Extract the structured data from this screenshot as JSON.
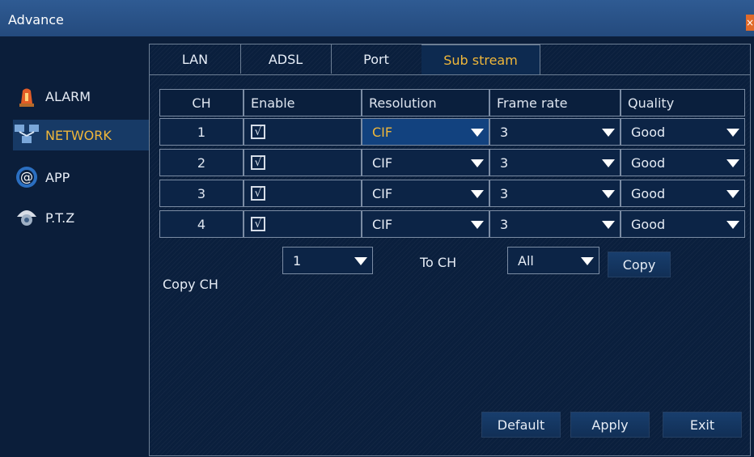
{
  "window": {
    "title": "Advance",
    "close_symbol": "×"
  },
  "sidebar": {
    "items": [
      {
        "label": "ALARM",
        "icon": "alarm-beacon-icon",
        "selected": false
      },
      {
        "label": "NETWORK",
        "icon": "network-icon",
        "selected": true
      },
      {
        "label": "APP",
        "icon": "at-sign-icon",
        "selected": false
      },
      {
        "label": "P.T.Z",
        "icon": "ptz-camera-icon",
        "selected": false
      }
    ]
  },
  "tabs": [
    {
      "label": "LAN",
      "active": false
    },
    {
      "label": "ADSL",
      "active": false
    },
    {
      "label": "Port",
      "active": false
    },
    {
      "label": "Sub stream",
      "active": true
    }
  ],
  "table": {
    "headers": [
      "CH",
      "Enable",
      "Resolution",
      "Frame rate",
      "Quality"
    ],
    "rows": [
      {
        "ch": "1",
        "enabled": true,
        "resolution": "CIF",
        "frame_rate": "3",
        "quality": "Good"
      },
      {
        "ch": "2",
        "enabled": true,
        "resolution": "CIF",
        "frame_rate": "3",
        "quality": "Good"
      },
      {
        "ch": "3",
        "enabled": true,
        "resolution": "CIF",
        "frame_rate": "3",
        "quality": "Good"
      },
      {
        "ch": "4",
        "enabled": true,
        "resolution": "CIF",
        "frame_rate": "3",
        "quality": "Good"
      }
    ]
  },
  "copy": {
    "copy_ch_label": "Copy CH",
    "copy_ch_value": "1",
    "to_ch_label": "To CH",
    "to_ch_value": "All",
    "copy_button": "Copy"
  },
  "footer": {
    "default_button": "Default",
    "apply_button": "Apply",
    "exit_button": "Exit"
  },
  "check_symbol": "√",
  "colors": {
    "accent": "#f0b73a",
    "background": "#0a1f3d",
    "selected_nav": "#173a66",
    "highlight": "#12427f",
    "title_bar": "#2f5b93",
    "close": "#e06a2a"
  }
}
